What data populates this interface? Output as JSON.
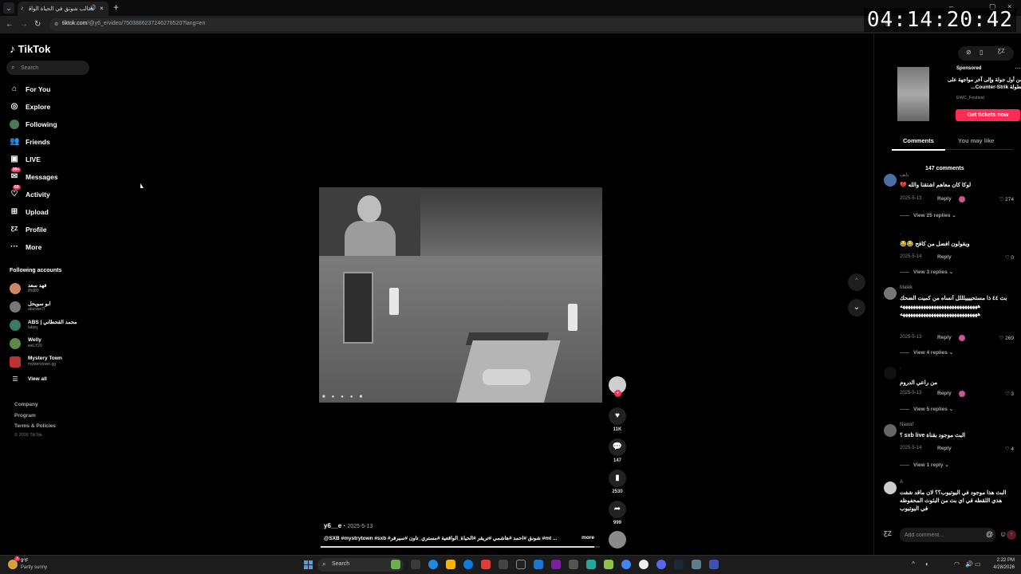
{
  "browser": {
    "tab_title": "مقالب شونق في الحياة الواقعية",
    "url_domain": "tiktok.com",
    "url_path": "/@y6_e/video/7503886237246278520?lang=en",
    "clock": "04:14:20:42"
  },
  "sidebar": {
    "logo": "TikTok",
    "search_placeholder": "Search",
    "nav": [
      {
        "label": "For You",
        "icon": "home-icon"
      },
      {
        "label": "Explore",
        "icon": "compass-icon"
      },
      {
        "label": "Following",
        "icon": "following-avatar-icon"
      },
      {
        "label": "Friends",
        "icon": "friends-icon"
      },
      {
        "label": "LIVE",
        "icon": "live-icon"
      },
      {
        "label": "Messages",
        "icon": "messages-icon",
        "badge": "99+"
      },
      {
        "label": "Activity",
        "icon": "activity-icon",
        "badge": "69"
      },
      {
        "label": "Upload",
        "icon": "upload-icon"
      },
      {
        "label": "Profile",
        "icon": "profile-icon"
      },
      {
        "label": "More",
        "icon": "more-icon"
      }
    ],
    "following_heading": "Following accounts",
    "accounts": [
      {
        "name": "فهد سعد",
        "handle": "ifhd89"
      },
      {
        "name": "ابو سويحل",
        "handle": "abuswe7l"
      },
      {
        "name": "ABS | محمد القحطاني",
        "handle": "labsq"
      },
      {
        "name": "Welly",
        "handle": "weLY20"
      },
      {
        "name": "Mystery Town",
        "handle": "mysterytown.gg"
      }
    ],
    "view_all": "View all",
    "footer_links": [
      "Company",
      "Program",
      "Terms & Policies"
    ],
    "copyright": "© 2026 TikTok"
  },
  "video": {
    "author": "y6__e",
    "date": "2025-5-13",
    "caption": "@SXB #mystrytown #sxb #شونق #احمد #هاشمي #تريقر #الحياة_الواقعية #مستري_تاون #سيرفر #mt ...",
    "more": "more",
    "likes": "11K",
    "comments": "147",
    "saves": "2530",
    "shares": "999",
    "progress": 0.98
  },
  "ad": {
    "label": "Sponsored",
    "title": "من أول جولة وإلى آخر مواجهة على بطولة Counter-Strik...",
    "org": "EWC_Festival",
    "cta": "Get tickets now"
  },
  "panel": {
    "tab_comments": "Comments",
    "tab_you_may_like": "You may like",
    "comment_count": "147 comments",
    "comments": [
      {
        "user": "نايف",
        "text": "لوكا كان معاهم اشتقنا والله 💔",
        "date": "2025-5-13",
        "reply": "Reply",
        "likes": "274",
        "view_replies": "View 25 replies"
      },
      {
        "user": ".",
        "text": "ويقولون افضل من كافح 😂😂",
        "date": "2025-5-14",
        "reply": "Reply",
        "likes": "0",
        "view_replies": "View 3 replies"
      },
      {
        "user": "Malek",
        "text": "بث ٤٤ ذا مستحييييلللل أنساه من كميت الضحك ههههههههههههههههههههههههههههههه ههههههههههههههههههههههههههههههه",
        "date": "2025-5-13",
        "reply": "Reply",
        "likes": "269",
        "view_replies": "View 4 replies"
      },
      {
        "user": ".",
        "text": "من راعي الدروم",
        "date": "2025-5-13",
        "reply": "Reply",
        "likes": "3",
        "view_replies": "View 5 replies"
      },
      {
        "user": "Nawaf",
        "text": "البث موجود بقناة sxb live ؟",
        "date": "2025-5-14",
        "reply": "Reply",
        "likes": "4",
        "view_replies": "View 1 reply"
      },
      {
        "user": "A",
        "text": "البث هذا موجود في اليوتيوب؟؟ لان ماقد شفت هذي اللقطه في اي بث من البثوث المحفوظه في اليوتيوب",
        "date": "",
        "reply": "",
        "likes": "",
        "view_replies": ""
      }
    ],
    "add_comment_placeholder": "Add comment..."
  },
  "taskbar": {
    "weather_temp": "9°F",
    "weather_cond": "Partly sunny",
    "weather_badge": "3",
    "search_label": "Search",
    "time": "2:22 PM",
    "date": "4/28/2026"
  }
}
